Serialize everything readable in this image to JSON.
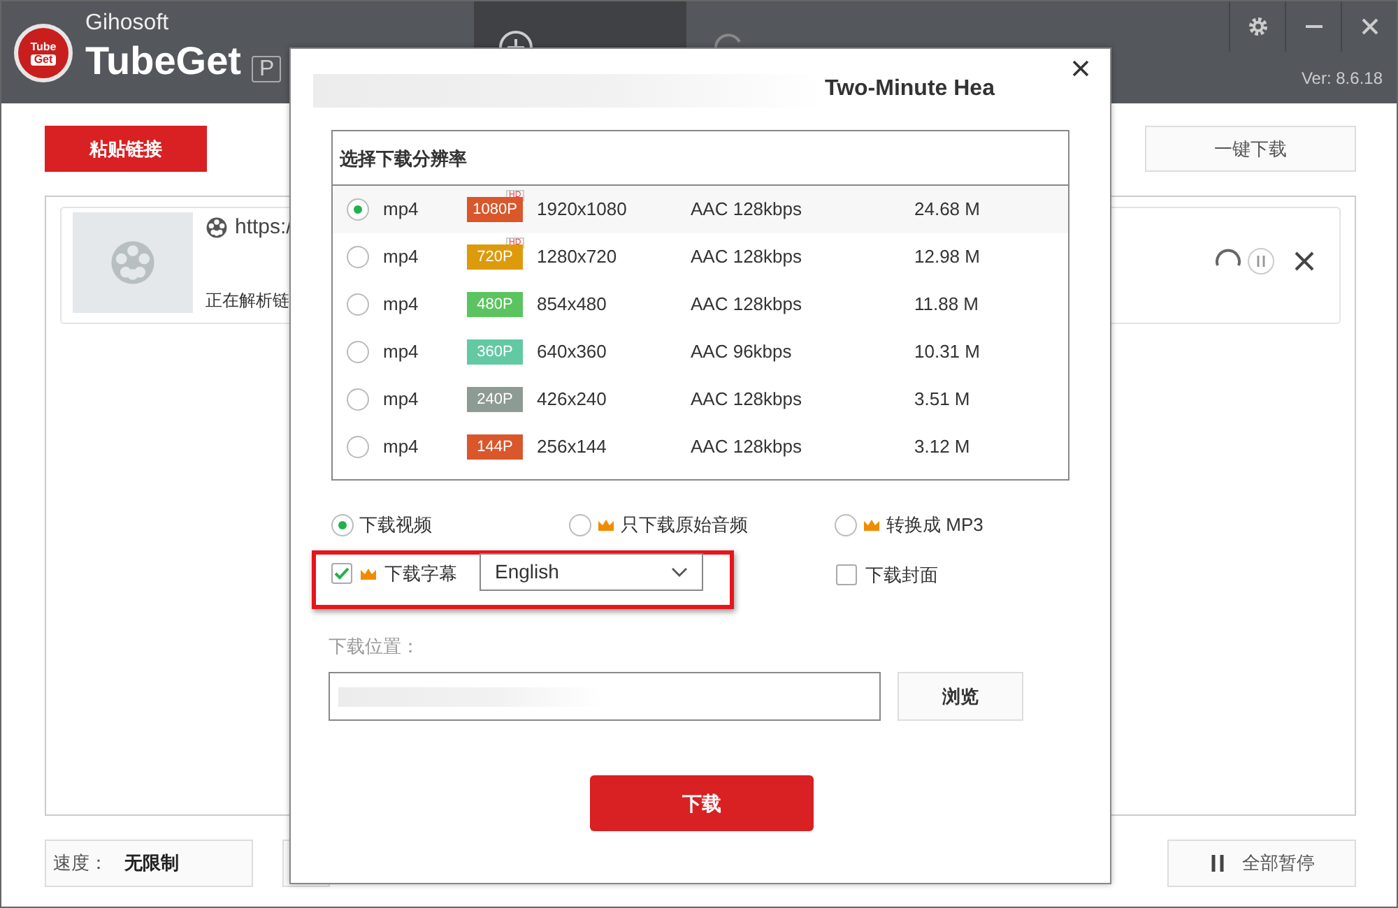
{
  "app": {
    "logo_top": "Tube",
    "logo_bottom": "Get",
    "brand": "Gihosoft",
    "name": "TubeGet",
    "edition": "P",
    "version": "Ver: 8.6.18"
  },
  "toolbar": {
    "paste": "粘贴链接",
    "one_click": "一键下载"
  },
  "downloads": [
    {
      "url": "https:/",
      "status": "正在解析链"
    }
  ],
  "footer": {
    "speed_label": "速度：",
    "speed_value": "无限制",
    "pause_all": "全部暂停"
  },
  "dialog": {
    "title": "Two-Minute Hea",
    "table_title": "选择下载分辨率",
    "formats": [
      {
        "selected": true,
        "format": "mp4",
        "quality": "1080P",
        "color": "#d9572b",
        "hd": "HD",
        "resolution": "1920x1080",
        "audio": "AAC 128kbps",
        "size": "24.68 M"
      },
      {
        "selected": false,
        "format": "mp4",
        "quality": "720P",
        "color": "#dd9a0b",
        "hd": "HD",
        "resolution": "1280x720",
        "audio": "AAC 128kbps",
        "size": "12.98 M"
      },
      {
        "selected": false,
        "format": "mp4",
        "quality": "480P",
        "color": "#5bc460",
        "resolution": "854x480",
        "audio": "AAC 128kbps",
        "size": "11.88 M"
      },
      {
        "selected": false,
        "format": "mp4",
        "quality": "360P",
        "color": "#63c9a3",
        "resolution": "640x360",
        "audio": "AAC 96kbps",
        "size": "10.31 M"
      },
      {
        "selected": false,
        "format": "mp4",
        "quality": "240P",
        "color": "#8e9a94",
        "resolution": "426x240",
        "audio": "AAC 128kbps",
        "size": "3.51 M"
      },
      {
        "selected": false,
        "format": "mp4",
        "quality": "144P",
        "color": "#d9572b",
        "resolution": "256x144",
        "audio": "AAC 128kbps",
        "size": "3.12 M"
      }
    ],
    "modes": [
      {
        "label": "下载视频",
        "premium": false,
        "selected": true
      },
      {
        "label": "只下载原始音频",
        "premium": true,
        "selected": false
      },
      {
        "label": "转换成 MP3",
        "premium": true,
        "selected": false
      }
    ],
    "subtitles": {
      "checked": true,
      "premium": true,
      "label": "下载字幕",
      "language": "English",
      "highlighted": true
    },
    "cover": {
      "checked": false,
      "label": "下载封面"
    },
    "location_label": "下载位置：",
    "browse": "浏览",
    "download": "下载"
  }
}
